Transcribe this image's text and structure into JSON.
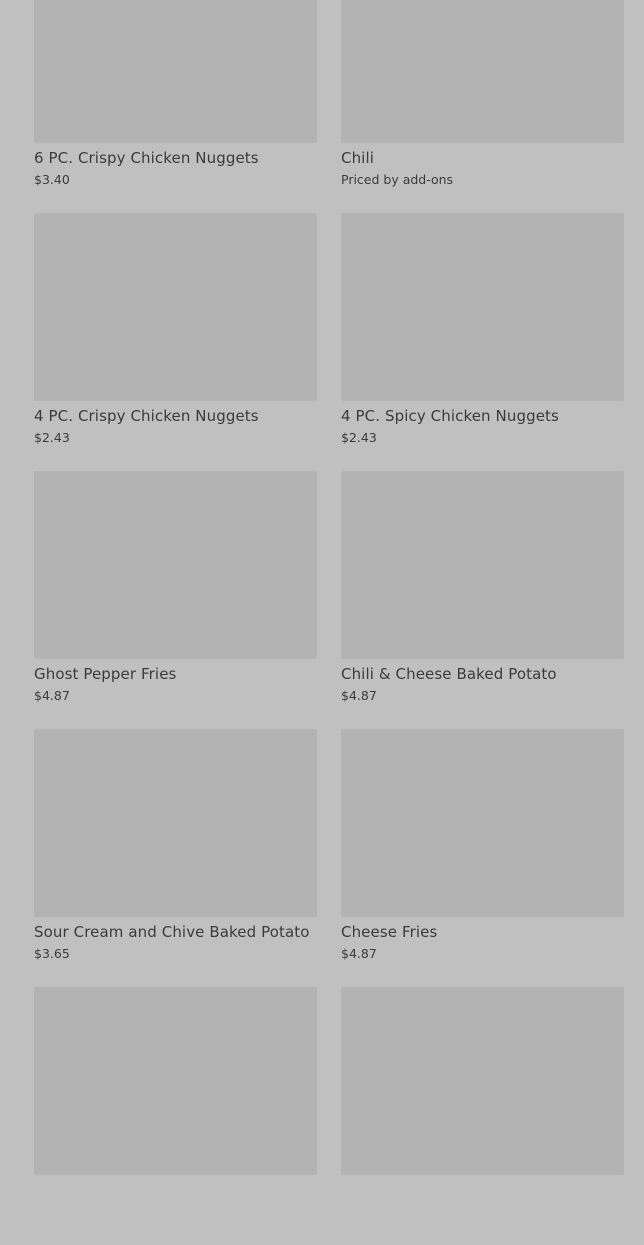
{
  "menu": {
    "items": [
      {
        "name": "6 PC. Crispy Chicken Nuggets",
        "price": "$3.40"
      },
      {
        "name": "Chili",
        "price": "Priced by add-ons"
      },
      {
        "name": "4 PC. Crispy Chicken Nuggets",
        "price": "$2.43"
      },
      {
        "name": "4 PC. Spicy Chicken Nuggets",
        "price": "$2.43"
      },
      {
        "name": "Ghost Pepper Fries",
        "price": "$4.87"
      },
      {
        "name": "Chili & Cheese Baked Potato",
        "price": "$4.87"
      },
      {
        "name": "Sour Cream and Chive Baked Potato",
        "price": "$3.65"
      },
      {
        "name": "Cheese Fries",
        "price": "$4.87"
      }
    ]
  }
}
